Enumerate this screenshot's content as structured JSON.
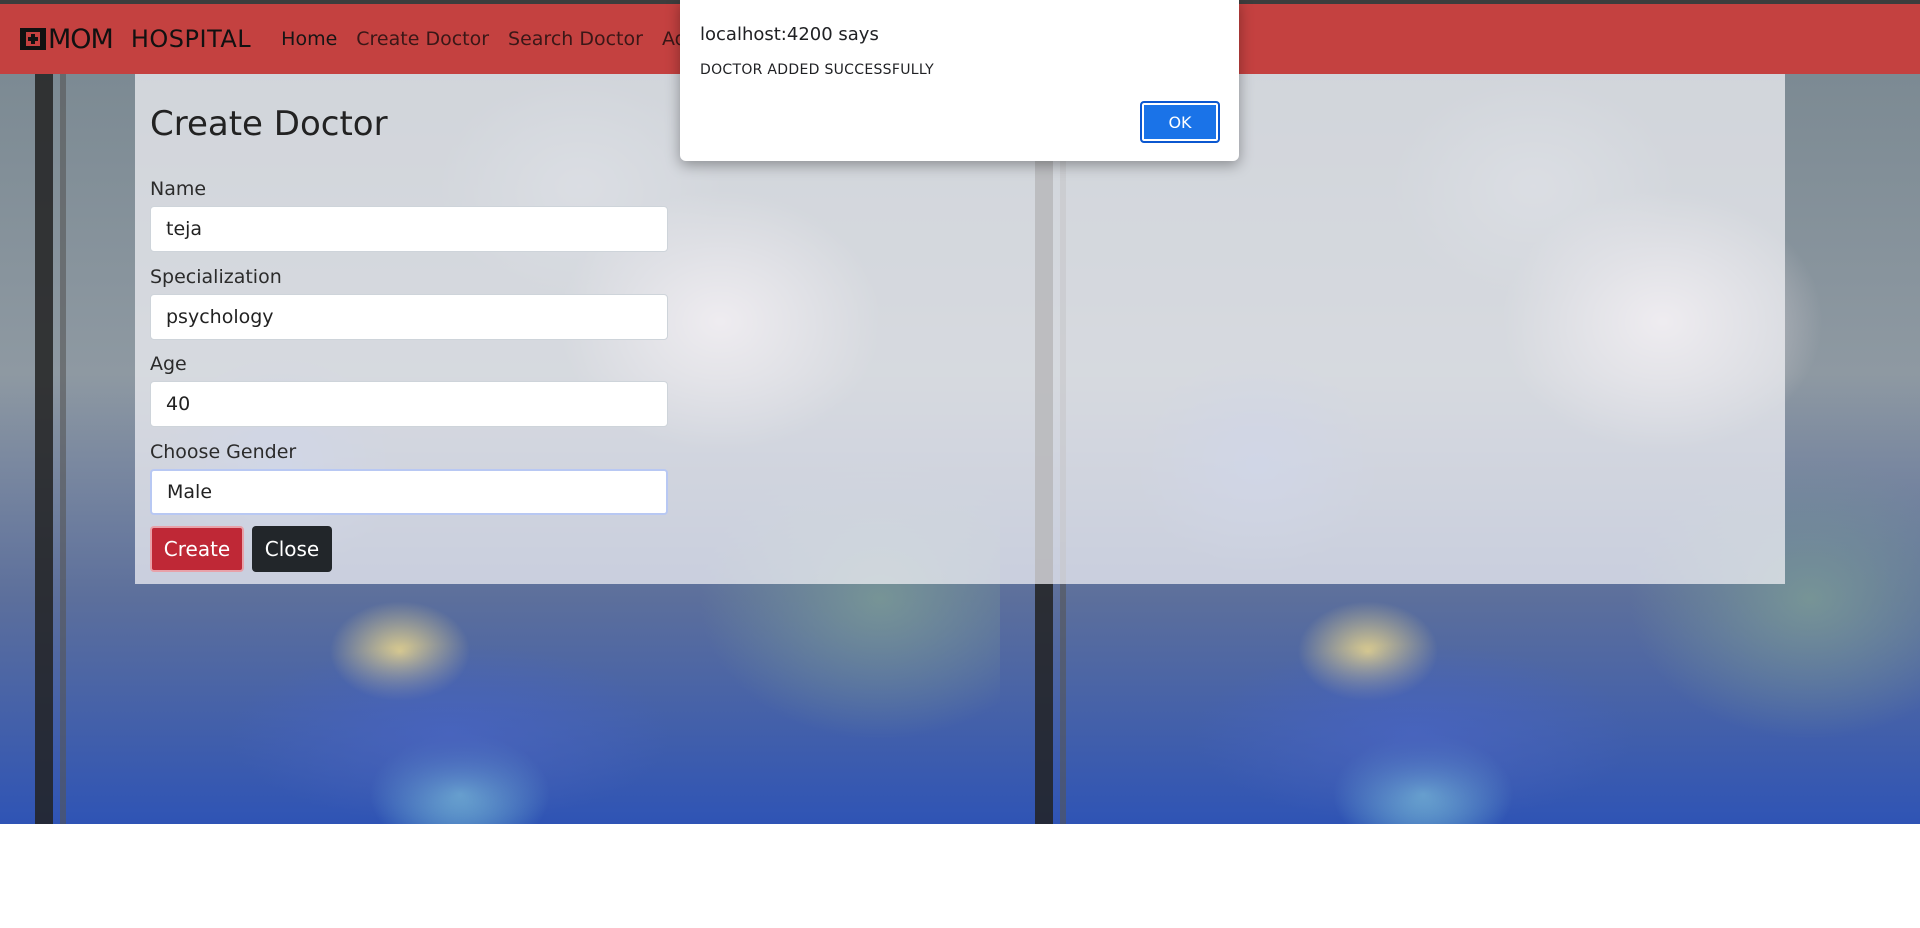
{
  "navbar": {
    "logo_text": "MOM",
    "brand_text": "HOSPITAL",
    "links": [
      {
        "label": "Home",
        "active": true
      },
      {
        "label": "Create Doctor",
        "active": false
      },
      {
        "label": "Search Doctor",
        "active": false
      },
      {
        "label": "Adm",
        "active": false
      }
    ],
    "background_color": "#c44140"
  },
  "form": {
    "title": "Create Doctor",
    "fields": [
      {
        "label": "Name",
        "value": "teja"
      },
      {
        "label": "Specialization",
        "value": "psychology"
      },
      {
        "label": "Age",
        "value": "40"
      },
      {
        "label": "Choose Gender",
        "value": "Male"
      }
    ],
    "create_label": "Create",
    "close_label": "Close"
  },
  "alert": {
    "title": "localhost:4200 says",
    "message": "DOCTOR ADDED SUCCESSFULLY",
    "ok_label": "OK"
  }
}
